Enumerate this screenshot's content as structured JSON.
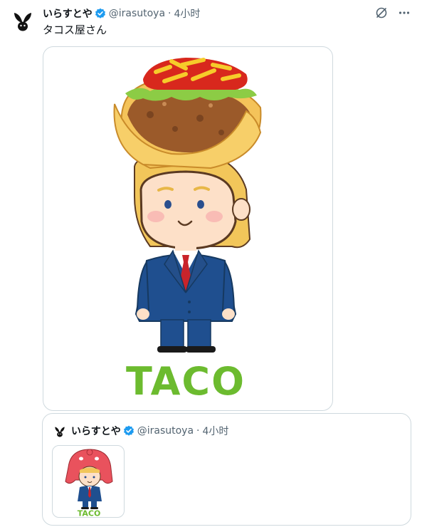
{
  "tweet": {
    "author_name": "いらすとや",
    "handle": "@irasutoya",
    "separator": "·",
    "time": "4小时",
    "text": "タコス屋さん",
    "media_label": "TACO"
  },
  "quote": {
    "author_name": "いらすとや",
    "handle": "@irasutoya",
    "separator": "·",
    "time": "4小时",
    "media_label": "TACO"
  },
  "colors": {
    "verified_blue": "#1d9bf0",
    "text_secondary": "#536471",
    "border": "#cfd9de",
    "taco_green": "#6cbb2f"
  },
  "icons": [
    "avatar-logo-icon",
    "verified-badge-icon",
    "grok-icon",
    "more-icon"
  ]
}
